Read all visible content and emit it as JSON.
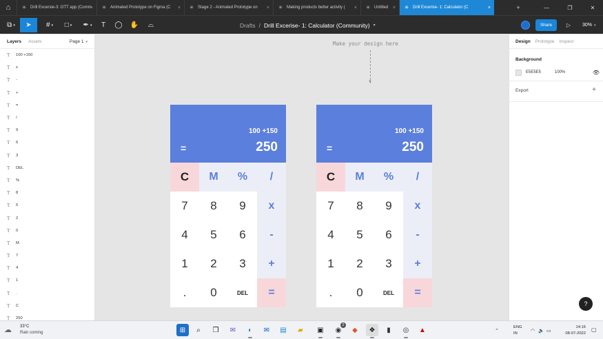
{
  "browser_tabs": [
    {
      "title": "Drill Excersie-3: OTT app (Comm",
      "active": false
    },
    {
      "title": "Animated Prototype on Figma (C",
      "active": false
    },
    {
      "title": "Stage 2 - Animated Prototype on",
      "active": false
    },
    {
      "title": "Making products better activity (",
      "active": false
    },
    {
      "title": "Untitled",
      "active": false
    },
    {
      "title": "Drill Excerise- 1: Calculator (C",
      "active": true
    }
  ],
  "tab_close_glyph": "×",
  "new_tab_glyph": "+",
  "toolbar": {
    "breadcrumb_root": "Drafts",
    "breadcrumb_sep": "/",
    "file_name": "Drill Excerise- 1: Calculator (Community)",
    "share_label": "Share",
    "zoom_label": "30%"
  },
  "left_panel": {
    "tab_layers": "Layers",
    "tab_assets": "Assets",
    "page_label": "Page 1",
    "text_icon_glyph": "T",
    "layers": [
      "100 +150",
      "x",
      "-",
      "+",
      "=",
      "/",
      "9",
      "6",
      "3",
      "DEL",
      "%",
      "8",
      "5",
      "2",
      "0",
      "M",
      "7",
      "4",
      "1",
      ".",
      "C",
      "250"
    ]
  },
  "right_panel": {
    "tab_design": "Design",
    "tab_prototype": "Prototype",
    "tab_inspect": "Inspect",
    "background_title": "Background",
    "background_hex": "E5E5E5",
    "background_opacity": "100%",
    "export_title": "Export",
    "plus_glyph": "+"
  },
  "help_glyph": "?",
  "canvas": {
    "hint": "Make your design here",
    "calculators": [
      {
        "expression": "100 +150",
        "result": "250",
        "equals_sign": "=",
        "keys": {
          "clear": "C",
          "memory": "M",
          "percent": "%",
          "divide": "/",
          "n7": "7",
          "n8": "8",
          "n9": "9",
          "multiply": "x",
          "n4": "4",
          "n5": "5",
          "n6": "6",
          "minus": "-",
          "n1": "1",
          "n2": "2",
          "n3": "3",
          "plus": "+",
          "dot": ".",
          "n0": "0",
          "delete": "DEL",
          "equals": "="
        }
      },
      {
        "expression": "100 +150",
        "result": "250",
        "equals_sign": "=",
        "keys": {
          "clear": "C",
          "memory": "M",
          "percent": "%",
          "divide": "/",
          "n7": "7",
          "n8": "8",
          "n9": "9",
          "multiply": "x",
          "n4": "4",
          "n5": "5",
          "n6": "6",
          "minus": "-",
          "n1": "1",
          "n2": "2",
          "n3": "3",
          "plus": "+",
          "dot": ".",
          "n0": "0",
          "delete": "DEL",
          "equals": "="
        }
      }
    ]
  },
  "taskbar": {
    "weather_temp": "33°C",
    "weather_desc": "Rain coming",
    "lang_line1": "ENG",
    "lang_line2": "IN",
    "time": "14:16",
    "date": "08-07-2022",
    "notification_badge": "2"
  },
  "colors": {
    "accent": "#1b85d8",
    "calc_display": "#5b7fdc",
    "calc_pink": "#f8d7da",
    "canvas_bg": "#e5e5e5"
  }
}
